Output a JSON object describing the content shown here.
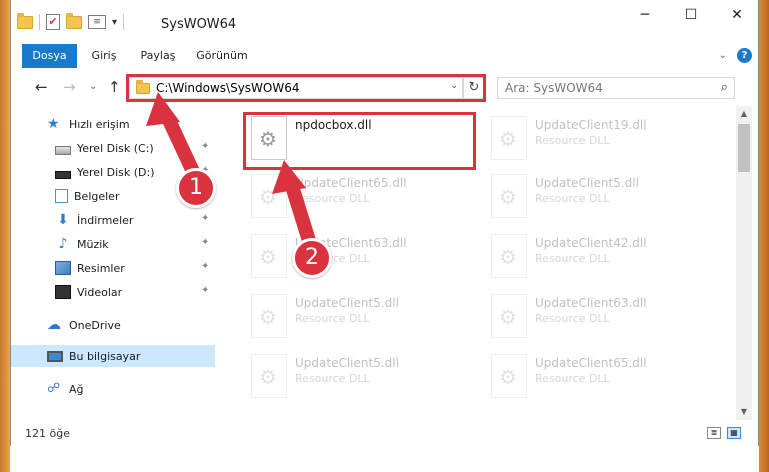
{
  "window": {
    "title": "SysWOW64",
    "minimize": "─",
    "maximize": "☐",
    "close": "✕"
  },
  "quick_access_toolbar": {
    "props_glyph": "≡",
    "check_glyph": "✔",
    "dropdown_glyph": "▾"
  },
  "ribbon": {
    "tabs": [
      "Dosya",
      "Giriş",
      "Paylaş",
      "Görünüm"
    ],
    "expand_glyph": "⌄",
    "help_glyph": "?"
  },
  "navigation": {
    "back": "←",
    "forward": "→",
    "recent": "⌄",
    "up": "↑",
    "address": "C:\\Windows\\SysWOW64",
    "address_dropdown": "⌄",
    "refresh": "↻",
    "search_placeholder": "Ara: SysWOW64",
    "search_glyph": "⌕"
  },
  "sidebar": {
    "items": [
      {
        "label": "Hızlı erişim",
        "icon": "star-icon",
        "pinned": false
      },
      {
        "label": "Yerel Disk (C:)",
        "icon": "drive-icon",
        "pinned": true
      },
      {
        "label": "Yerel Disk (D:)",
        "icon": "drive-icon",
        "pinned": true
      },
      {
        "label": "Belgeler",
        "icon": "documents-icon",
        "pinned": false
      },
      {
        "label": "İndirmeler",
        "icon": "downloads-icon",
        "pinned": true
      },
      {
        "label": "Müzik",
        "icon": "music-icon",
        "pinned": true
      },
      {
        "label": "Resimler",
        "icon": "pictures-icon",
        "pinned": true
      },
      {
        "label": "Videolar",
        "icon": "videos-icon",
        "pinned": true
      },
      {
        "label": "OneDrive",
        "icon": "cloud-icon",
        "pinned": false
      },
      {
        "label": "Bu bilgisayar",
        "icon": "computer-icon",
        "pinned": false,
        "selected": true
      },
      {
        "label": "Ağ",
        "icon": "network-icon",
        "pinned": false
      }
    ],
    "pin_glyph": "✦",
    "star_glyph": "★",
    "down_glyph": "⬇",
    "music_glyph": "♪",
    "cloud_glyph": "☁",
    "net_glyph": "☍"
  },
  "files": [
    {
      "name": "npdocbox.dll",
      "type": "",
      "highlighted": true
    },
    {
      "name": "UpdateClient19.dll",
      "type": "Resource DLL"
    },
    {
      "name": "UpdateClient65.dll",
      "type": "Resource DLL"
    },
    {
      "name": "UpdateClient5.dll",
      "type": "Resource DLL"
    },
    {
      "name": "UpdateClient63.dll",
      "type": "Resource DLL"
    },
    {
      "name": "UpdateClient42.dll",
      "type": "Resource DLL"
    },
    {
      "name": "UpdateClient5.dll",
      "type": "Resource DLL"
    },
    {
      "name": "UpdateClient63.dll",
      "type": "Resource DLL"
    },
    {
      "name": "UpdateClient5.dll",
      "type": "Resource DLL"
    },
    {
      "name": "UpdateClient65.dll",
      "type": "Resource DLL"
    }
  ],
  "scrollbar": {
    "up": "▲",
    "down": "▼"
  },
  "status": {
    "item_count": "121 öğe",
    "details_view_glyph": "≣",
    "icons_view_glyph": "▦"
  },
  "annotations": {
    "step1": "1",
    "step2": "2",
    "color": "#d9333f"
  }
}
